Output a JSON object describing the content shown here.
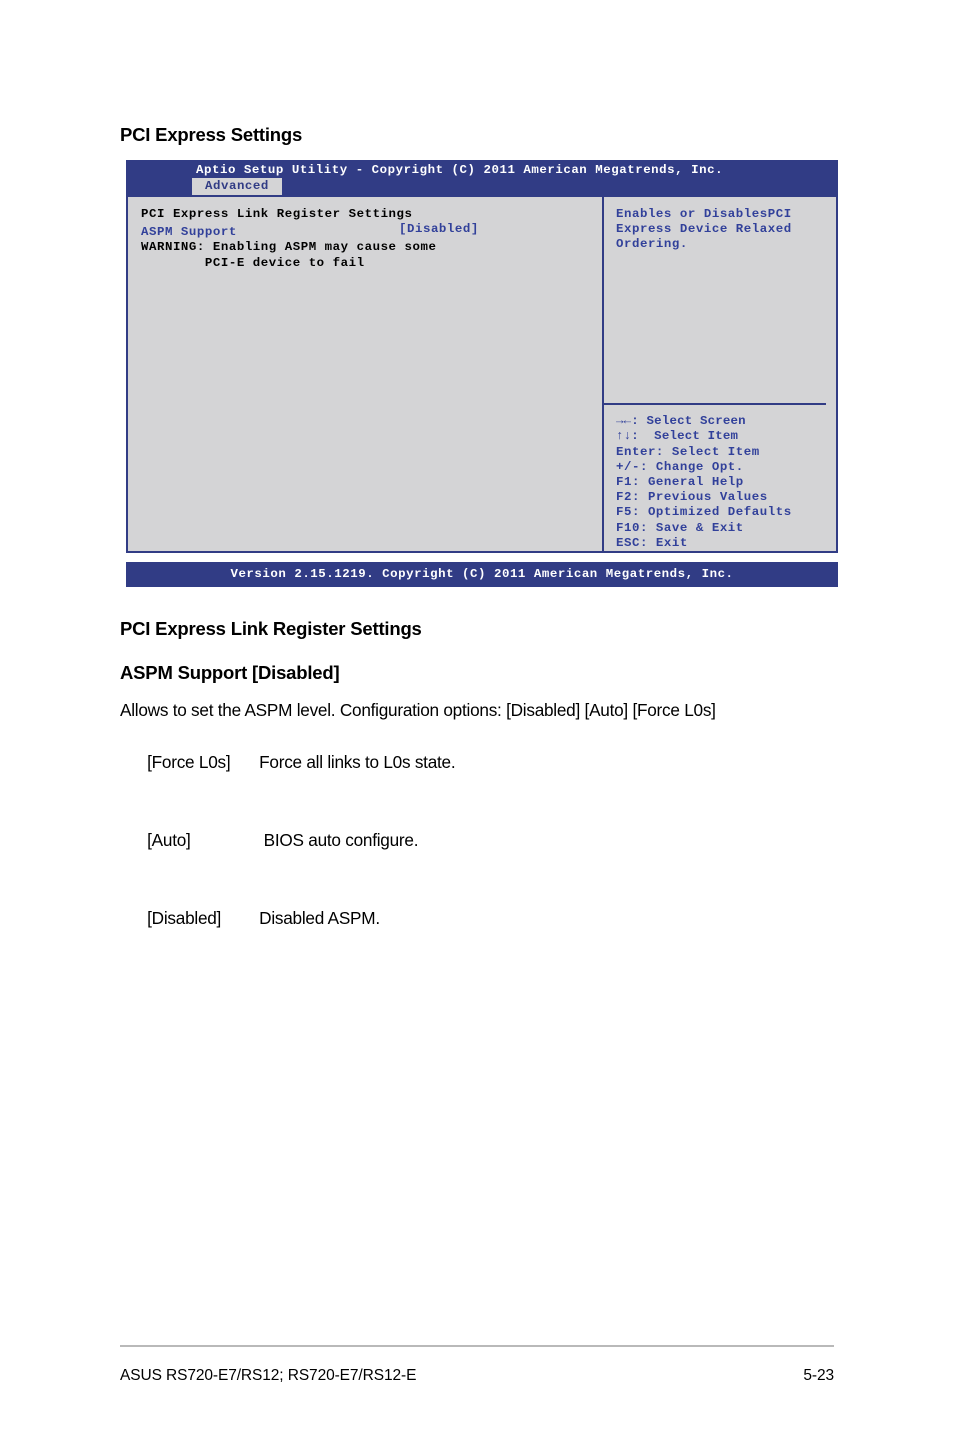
{
  "headings": {
    "pci_express_settings": "PCI Express Settings",
    "link_register_settings": "PCI Express Link Register Settings",
    "aspm_support": "ASPM Support [Disabled]"
  },
  "bios": {
    "titlebar": "Aptio Setup Utility - Copyright (C) 2011 American Megatrends, Inc.",
    "active_tab": "Advanced",
    "left_panel": {
      "section_label": "PCI Express Link Register Settings",
      "setting_name": "ASPM Support",
      "setting_value": "[Disabled]",
      "warning_line1": "WARNING: Enabling ASPM may cause some",
      "warning_line2": "        PCI-E device to fail"
    },
    "right_panel": {
      "help_line1": "Enables or DisablesPCI",
      "help_line2": "Express Device Relaxed",
      "help_line3": "Ordering.",
      "keys": [
        "→←: Select Screen",
        "↑↓:  Select Item",
        "Enter: Select Item",
        "+/-: Change Opt.",
        "F1: General Help",
        "F2: Previous Values",
        "F5: Optimized Defaults",
        "F10: Save & Exit",
        "ESC: Exit"
      ]
    },
    "footer": "Version 2.15.1219. Copyright (C) 2011 American Megatrends, Inc.",
    "colors": {
      "header_blue": "#313c85",
      "panel_gray": "#d4d4d6",
      "text_blue": "#31409a"
    }
  },
  "description": {
    "intro": "Allows to set the ASPM level. Configuration options: [Disabled] [Auto] [Force L0s]",
    "options": [
      {
        "key": "[Force L0s]",
        "text": "Force all links to L0s state."
      },
      {
        "key": "[Auto]",
        "text": " BIOS auto configure."
      },
      {
        "key": "[Disabled]",
        "text": "Disabled ASPM."
      }
    ]
  },
  "page_footer": {
    "left": "ASUS RS720-E7/RS12; RS720-E7/RS12-E",
    "page_number": "5-23"
  }
}
